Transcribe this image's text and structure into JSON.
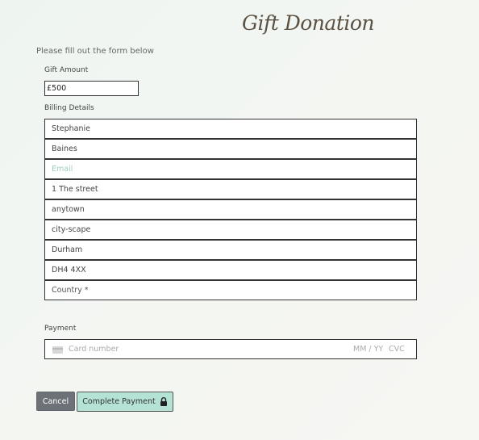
{
  "page": {
    "title": "Gift Donation",
    "intro": "Please fill out the form below"
  },
  "gift": {
    "label": "Gift Amount",
    "value": "£500"
  },
  "billing": {
    "label": "Billing Details",
    "first_name": "Stephanie",
    "last_name": "Baines",
    "email_placeholder": "Email",
    "street": "1 The street",
    "town": "anytown",
    "city": "city-scape",
    "county": "Durham",
    "postcode": "DH4 4XX",
    "country_placeholder": "Country *"
  },
  "payment": {
    "label": "Payment",
    "card_placeholder": "Card number",
    "expiry_placeholder": "MM / YY",
    "cvc_placeholder": "CVC"
  },
  "actions": {
    "cancel_label": "Cancel",
    "complete_label": "Complete Payment"
  },
  "icons": {
    "card": "credit-card-icon",
    "lock": "lock-icon"
  },
  "colors": {
    "accent": "#b4e2d4",
    "cancel": "#6c7278",
    "title": "#5b5143",
    "placeholder_accent": "#9fcdbd"
  }
}
